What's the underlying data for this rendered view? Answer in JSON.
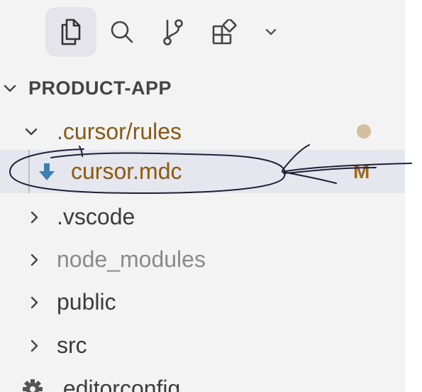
{
  "explorer": {
    "toolbar": [
      {
        "name": "explorer-files-icon",
        "active": true
      },
      {
        "name": "search-icon",
        "active": false
      },
      {
        "name": "source-control-icon",
        "active": false
      },
      {
        "name": "extensions-icon",
        "active": false
      },
      {
        "name": "chevron-down-icon",
        "active": false
      }
    ],
    "project": {
      "name": "PRODUCT-APP",
      "expanded": true
    },
    "tree": [
      {
        "folder": ".cursor",
        "separator": "/",
        "subfolder": "rules",
        "expanded": true,
        "status_dot": true
      },
      {
        "file": "cursor.mdc",
        "icon": "download-arrow-icon",
        "badge": "M",
        "selected": true
      },
      {
        "label": ".vscode"
      },
      {
        "label": "node_modules",
        "ignored": true
      },
      {
        "label": "public"
      },
      {
        "label": "src"
      },
      {
        "label": ".editorconfig",
        "icon": "gear-icon"
      }
    ]
  },
  "colors": {
    "background": "#f3f3f3",
    "selected_row": "#e6e6ef",
    "modified_text": "#8a5a12",
    "modified_badge": "#9a6a1e",
    "status_dot": "#d3bea0",
    "file_icon": "#3b7fb5",
    "ignored_text": "#8a8a8a"
  }
}
